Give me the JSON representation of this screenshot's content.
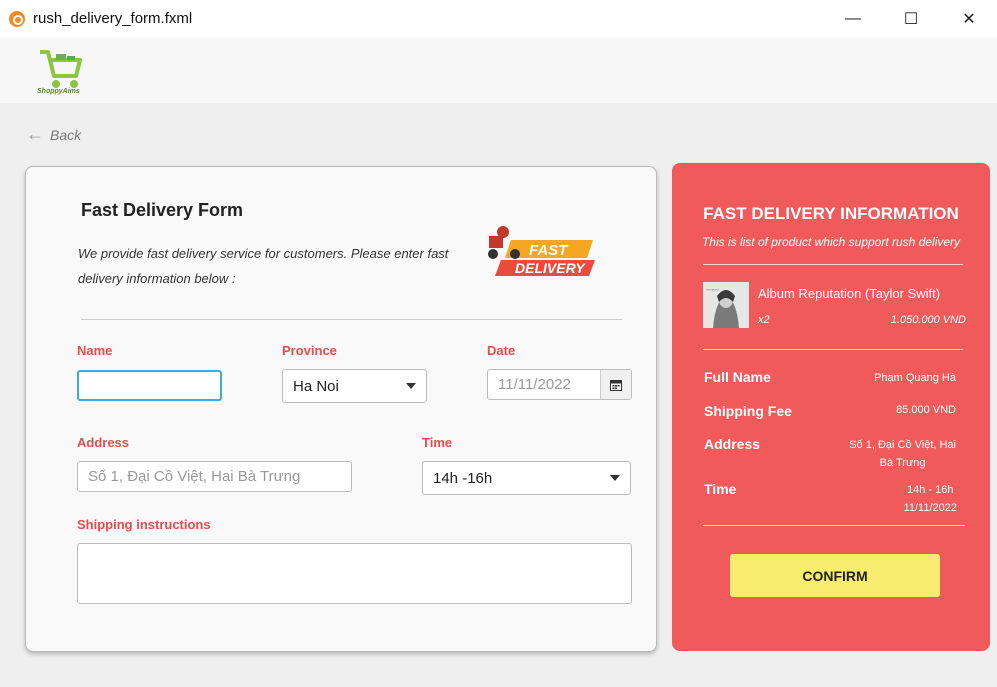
{
  "window": {
    "title": "rush_delivery_form.fxml",
    "minimize": "—",
    "maximize": "☐",
    "close": "✕"
  },
  "brand": {
    "logo_text": "ShoppyAims"
  },
  "nav": {
    "back_label": "Back"
  },
  "form": {
    "title": "Fast Delivery Form",
    "description": "We provide fast delivery service for customers. Please enter fast delivery information below :",
    "badge_line1": "FAST",
    "badge_line2": "DELIVERY",
    "name": {
      "label": "Name",
      "value": ""
    },
    "province": {
      "label": "Province",
      "value": "Ha Noi"
    },
    "date": {
      "label": "Date",
      "placeholder": "11/11/2022"
    },
    "address": {
      "label": "Address",
      "placeholder": "Số 1, Đại Cồ Việt, Hai Bà Trưng"
    },
    "time": {
      "label": "Time",
      "value": "14h -16h"
    },
    "instructions": {
      "label": "Shipping instructions",
      "value": ""
    }
  },
  "info": {
    "title": "FAST DELIVERY INFORMATION",
    "subtitle": "This is list of product which support rush delivery",
    "product": {
      "name": "Album Reputation (Taylor Swift)",
      "qty": "x2",
      "price": "1.050.000 VND"
    },
    "full_name": {
      "label": "Full Name",
      "value": "Phạm Quang Hà"
    },
    "shipping_fee": {
      "label": "Shipping Fee",
      "value": "85.000 VND"
    },
    "address": {
      "label": "Address",
      "value_line1": "Số 1, Đại Cồ Việt, Hai",
      "value_line2": "Bà Trưng"
    },
    "time": {
      "label": "Time",
      "value_line1": "14h - 16h",
      "value_line2": "11/11/2022"
    },
    "confirm_label": "CONFIRM"
  }
}
